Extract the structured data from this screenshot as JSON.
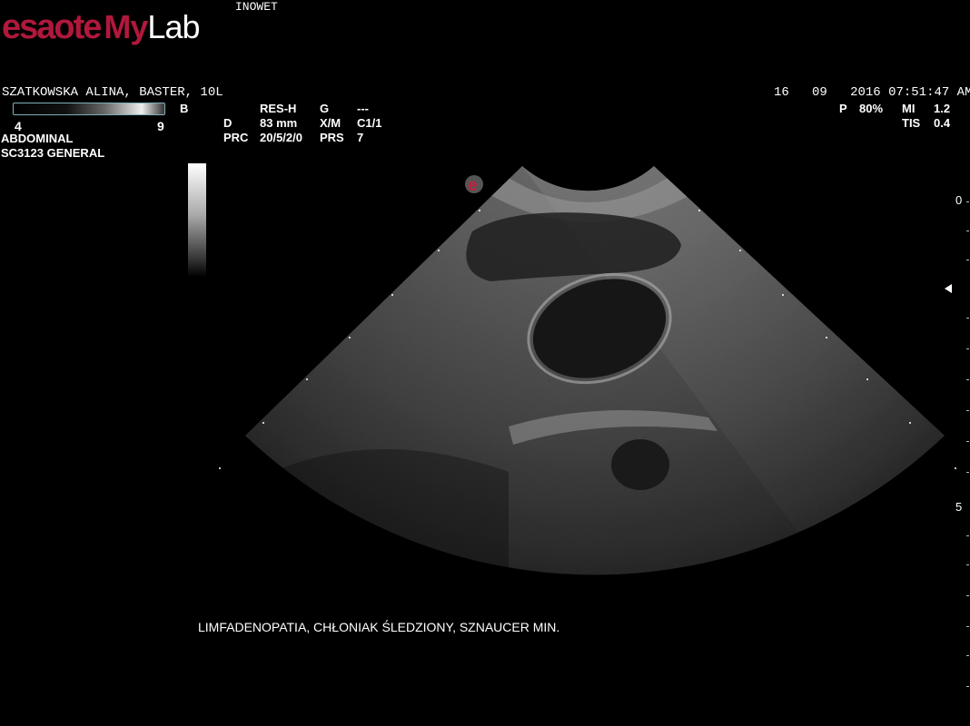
{
  "header": {
    "logo_brand": "esaote",
    "logo_product_my": "My",
    "logo_product_lab": "Lab",
    "clinic": "INOWET"
  },
  "patient": {
    "name_line": "SZATKOWSKA ALINA, BASTER, 10L"
  },
  "datetime": {
    "day": "16",
    "month": "09",
    "time": "2016 07:51:47 AM"
  },
  "grayscale": {
    "mode": "B",
    "min": "4",
    "max": "9"
  },
  "params": {
    "col1": [
      {
        "label": "",
        "value": "RES-H"
      },
      {
        "label": "D",
        "value": "83 mm"
      },
      {
        "label": "PRC",
        "value": "20/5/2/0"
      }
    ],
    "col2": [
      {
        "label": "G",
        "value": "---"
      },
      {
        "label": "X/M",
        "value": "C1/1"
      },
      {
        "label": "PRS",
        "value": "7"
      }
    ],
    "power": {
      "label": "P",
      "value": "80%"
    },
    "mi": {
      "label": "MI",
      "value": "1.2"
    },
    "tis": {
      "label": "TIS",
      "value": "0.4"
    }
  },
  "exam": {
    "preset": "ABDOMINAL",
    "probe": "SC3123  GENERAL"
  },
  "depth_scale": {
    "label_top": "0",
    "label_mid": "5"
  },
  "caption": "LIMFADENOPATIA, CHŁONIAK ŚLEDZIONY, SZNAUCER MIN.",
  "colors": {
    "brand_red": "#b0183c",
    "bar_border": "#7fb0b8"
  }
}
